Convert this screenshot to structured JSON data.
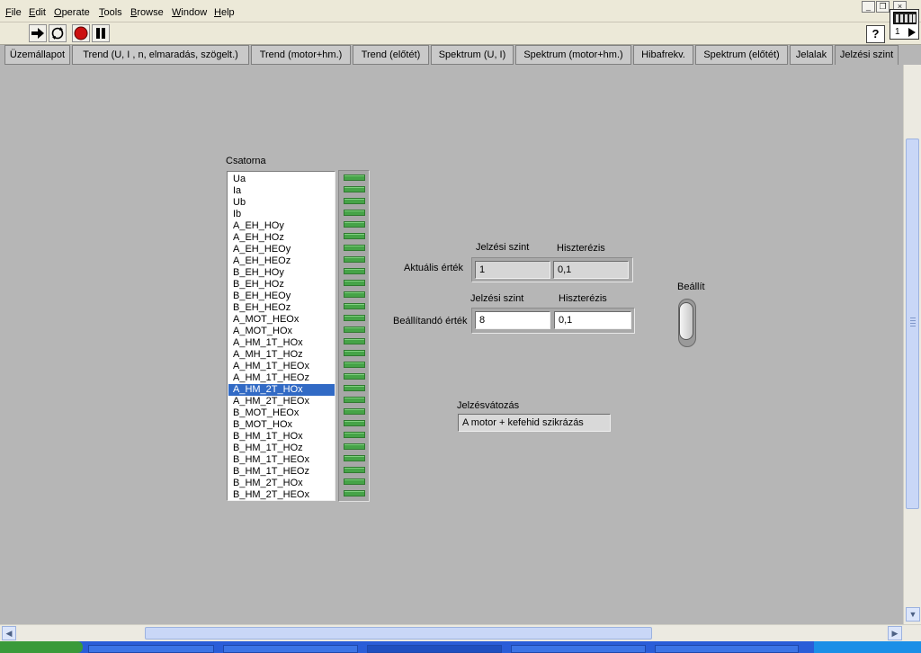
{
  "menu": {
    "items": [
      {
        "label": "File",
        "ul": "F",
        "rest": "ile"
      },
      {
        "label": "Edit",
        "ul": "E",
        "rest": "dit"
      },
      {
        "label": "Operate",
        "ul": "O",
        "rest": "perate"
      },
      {
        "label": "Tools",
        "ul": "T",
        "rest": "ools"
      },
      {
        "label": "Browse",
        "ul": "B",
        "rest": "rowse"
      },
      {
        "label": "Window",
        "ul": "W",
        "rest": "indow"
      },
      {
        "label": "Help",
        "ul": "H",
        "rest": "elp"
      }
    ]
  },
  "window_buttons": {
    "minimize": "_",
    "restore": "❐",
    "close": "×"
  },
  "toolbar": {
    "buttons": [
      "run-icon",
      "run-continuously-icon",
      "abort-icon",
      "pause-icon"
    ],
    "help_label": "?",
    "vi_icon_number": "1"
  },
  "tabs": [
    "Üzemállapot",
    "Trend (U, I , n, elmaradás,  szögelt.)",
    "Trend (motor+hm.)",
    "Trend (előtét)",
    "Spektrum (U, I)",
    "Spektrum (motor+hm.)",
    "Hibafrekv.",
    "Spektrum (előtét)",
    "Jelalak",
    "Jelzési szint"
  ],
  "active_tab": "Jelzési szint",
  "channel": {
    "label": "Csatorna",
    "items": [
      "Ua",
      "Ia",
      "Ub",
      "Ib",
      "A_EH_HOy",
      "A_EH_HOz",
      "A_EH_HEOy",
      "A_EH_HEOz",
      "B_EH_HOy",
      "B_EH_HOz",
      "B_EH_HEOy",
      "B_EH_HEOz",
      "A_MOT_HEOx",
      "A_MOT_HOx",
      "A_HM_1T_HOx",
      "A_MH_1T_HOz",
      "A_HM_1T_HEOx",
      "A_HM_1T_HEOz",
      "A_HM_2T_HOx",
      "A_HM_2T_HEOx",
      "B_MOT_HEOx",
      "B_MOT_HOx",
      "B_HM_1T_HOx",
      "B_HM_1T_HOz",
      "B_HM_1T_HEOx",
      "B_HM_1T_HEOz",
      "B_HM_2T_HOx",
      "B_HM_2T_HEOx"
    ],
    "selected": "A_HM_2T_HOx",
    "led_count": 28,
    "led_color": "#46a348"
  },
  "current": {
    "row_label": "Aktuális érték",
    "col1_label": "Jelzési szint",
    "col2_label": "Hiszterézis",
    "level": "1",
    "hysteresis": "0,1"
  },
  "setpoint": {
    "row_label": "Beállítandó érték",
    "col1_label": "Jelzési szint",
    "col2_label": "Hiszterézis",
    "level": "8",
    "hysteresis": "0,1"
  },
  "set_button": {
    "label": "Beállít"
  },
  "alarm": {
    "label": "Jelzésvátozás",
    "value": "A motor + kefehid szikrázás"
  },
  "colors": {
    "panel_bg": "#b6b6b6",
    "selection": "#316ac5",
    "menubar": "#ece9d8"
  }
}
